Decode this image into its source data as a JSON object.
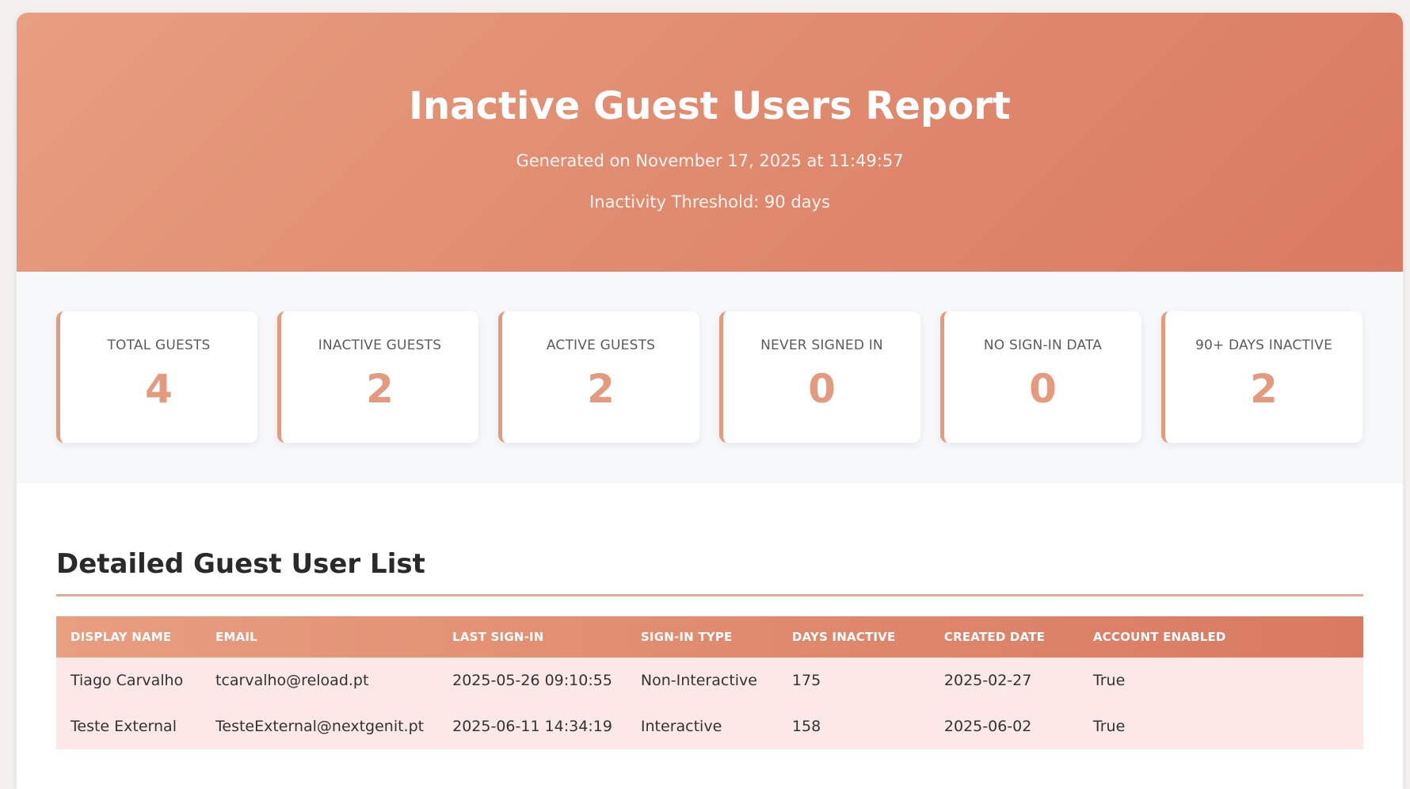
{
  "header": {
    "title": "Inactive Guest Users Report",
    "generated": "Generated on November 17, 2025 at 11:49:57",
    "threshold": "Inactivity Threshold: 90 days"
  },
  "stats": [
    {
      "label": "TOTAL GUESTS",
      "value": "4"
    },
    {
      "label": "INACTIVE GUESTS",
      "value": "2"
    },
    {
      "label": "ACTIVE GUESTS",
      "value": "2"
    },
    {
      "label": "NEVER SIGNED IN",
      "value": "0"
    },
    {
      "label": "NO SIGN-IN DATA",
      "value": "0"
    },
    {
      "label": "90+ DAYS INACTIVE",
      "value": "2"
    }
  ],
  "details": {
    "title": "Detailed Guest User List",
    "columns": [
      "DISPLAY NAME",
      "EMAIL",
      "LAST SIGN-IN",
      "SIGN-IN TYPE",
      "DAYS INACTIVE",
      "CREATED DATE",
      "ACCOUNT ENABLED"
    ],
    "rows": [
      [
        "Tiago Carvalho",
        "tcarvalho@reload.pt",
        "2025-05-26 09:10:55",
        "Non-Interactive",
        "175",
        "2025-02-27",
        "True"
      ],
      [
        "Teste External",
        "TesteExternal@nextgenit.pt",
        "2025-06-11 14:34:19",
        "Interactive",
        "158",
        "2025-06-02",
        "True"
      ]
    ]
  },
  "colors": {
    "accent": "#e39a7e",
    "header_start": "#e89e81",
    "header_end": "#d97a62",
    "row_bg": "#fde8e8"
  }
}
